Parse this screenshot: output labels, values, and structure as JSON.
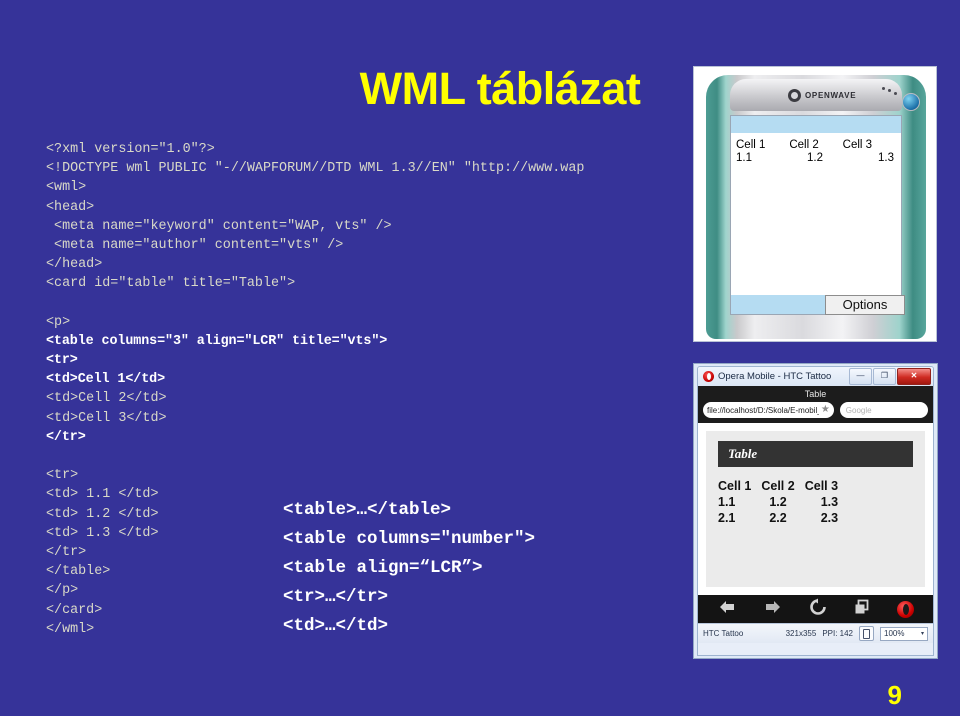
{
  "slide": {
    "title": "WML táblázat",
    "page_number": "9",
    "background_color": "#363399",
    "title_color": "#ffff00"
  },
  "code_listing": [
    {
      "text": "<?xml version=\"1.0\"?>",
      "bold": false
    },
    {
      "text": "<!DOCTYPE wml PUBLIC \"-//WAPFORUM//DTD WML 1.3//EN\" \"http://www.wap",
      "bold": false
    },
    {
      "text": "<wml>",
      "bold": false
    },
    {
      "text": "<head>",
      "bold": false
    },
    {
      "text": " <meta name=\"keyword\" content=\"WAP, vts\" />",
      "bold": false
    },
    {
      "text": " <meta name=\"author\" content=\"vts\" />",
      "bold": false
    },
    {
      "text": "</head>",
      "bold": false
    },
    {
      "text": "<card id=\"table\" title=\"Table\">",
      "bold": false
    },
    {
      "text": "",
      "bold": false
    },
    {
      "text": "<p>",
      "bold": false
    },
    {
      "text": "<table columns=\"3\" align=\"LCR\" title=\"vts\">",
      "bold": true
    },
    {
      "text": "<tr>",
      "bold": true
    },
    {
      "text": "<td>Cell 1</td>",
      "bold": true
    },
    {
      "text": "<td>Cell 2</td>",
      "bold": false
    },
    {
      "text": "<td>Cell 3</td>",
      "bold": false
    },
    {
      "text": "</tr>",
      "bold": true
    },
    {
      "text": "",
      "bold": false
    },
    {
      "text": "<tr>",
      "bold": false
    },
    {
      "text": "<td> 1.1 </td>",
      "bold": false
    },
    {
      "text": "<td> 1.2 </td>",
      "bold": false
    },
    {
      "text": "<td> 1.3 </td>",
      "bold": false
    },
    {
      "text": "</tr>",
      "bold": false
    },
    {
      "text": "</table>",
      "bold": false
    },
    {
      "text": "</p>",
      "bold": false
    },
    {
      "text": "</card>",
      "bold": false
    },
    {
      "text": "</wml>",
      "bold": false
    }
  ],
  "syntax_summary": [
    "<table>…</table>",
    "<table columns=\"number\">",
    "<table align=“LCR”>",
    "<tr>…</tr>",
    "<td>…</td>"
  ],
  "openwave": {
    "brand": "OPENWAVE",
    "softkey_label": "Options",
    "table": {
      "header": [
        "Cell 1",
        "Cell 2",
        "Cell 3"
      ],
      "rows": [
        [
          "1.1",
          "1.2",
          "1.3"
        ]
      ]
    }
  },
  "opera": {
    "window_title": "Opera Mobile - HTC Tattoo",
    "window_buttons": {
      "minimize": "—",
      "maximize": "❐",
      "close": "✕"
    },
    "page_title": "Table",
    "url": "file://localhost/D:/Skola/E-mobil_",
    "bookmark_icon": "★",
    "search_placeholder": "Google",
    "card_title": "Table",
    "table": {
      "header": [
        "Cell 1",
        "Cell 2",
        "Cell 3"
      ],
      "rows": [
        [
          "1.1",
          "1.2",
          "1.3"
        ],
        [
          "2.1",
          "2.2",
          "2.3"
        ]
      ]
    },
    "toolbar": [
      "back-icon",
      "forward-icon",
      "reload-icon",
      "tabs-icon",
      "opera-menu-icon"
    ],
    "status": {
      "device": "HTC Tattoo",
      "resolution": "321x355",
      "ppi": "PPI: 142",
      "zoom": "100%",
      "zoom_caret": "▾"
    }
  }
}
